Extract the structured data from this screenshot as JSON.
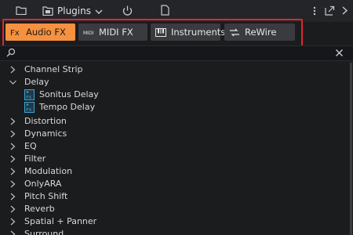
{
  "toolbar": {
    "plugins_label": "Plugins"
  },
  "tabs": [
    {
      "label": "Audio FX",
      "icon": "fx-icon",
      "active": true
    },
    {
      "label": "MIDI FX",
      "icon": "midi-icon",
      "active": false
    },
    {
      "label": "Instruments",
      "icon": "keyboard-icon",
      "active": false
    },
    {
      "label": "ReWire",
      "icon": "rewire-icon",
      "active": false
    }
  ],
  "search": {
    "value": "",
    "placeholder": ""
  },
  "tree": {
    "items": [
      {
        "label": "Channel Strip",
        "expanded": false
      },
      {
        "label": "Delay",
        "expanded": true
      },
      {
        "label": "Sonitus Delay",
        "child": true
      },
      {
        "label": "Tempo Delay",
        "child": true
      },
      {
        "label": "Distortion",
        "expanded": false
      },
      {
        "label": "Dynamics",
        "expanded": false
      },
      {
        "label": "EQ",
        "expanded": false
      },
      {
        "label": "Filter",
        "expanded": false
      },
      {
        "label": "Modulation",
        "expanded": false
      },
      {
        "label": "OnlyARA",
        "expanded": false
      },
      {
        "label": "Pitch Shift",
        "expanded": false
      },
      {
        "label": "Reverb",
        "expanded": false
      },
      {
        "label": "Spatial + Panner",
        "expanded": false
      },
      {
        "label": "Surround",
        "expanded": false
      }
    ]
  },
  "colors": {
    "accent": "#f5913f",
    "highlight_border": "#e0262f",
    "plugin_icon": "#3aa6d8"
  }
}
